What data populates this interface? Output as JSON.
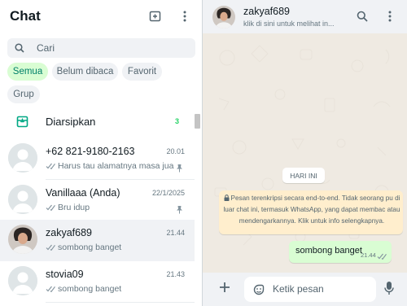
{
  "sidebar": {
    "title": "Chat",
    "search_placeholder": "Cari",
    "filters": [
      {
        "label": "Semua",
        "active": true
      },
      {
        "label": "Belum dibaca",
        "active": false
      },
      {
        "label": "Favorit",
        "active": false
      },
      {
        "label": "Grup",
        "active": false
      }
    ],
    "archived": {
      "label": "Diarsipkan",
      "count": "3"
    },
    "chats": [
      {
        "name": "+62 821-9180-2163",
        "time": "20.01",
        "preview": "Harus tau alamatnya masa jual...",
        "pinned": true,
        "selected": false
      },
      {
        "name": "Vanillaaa (Anda)",
        "time": "22/1/2025",
        "preview": "Bru idup",
        "pinned": true,
        "selected": false
      },
      {
        "name": "zakyaf689",
        "time": "21.44",
        "preview": "sombong banget",
        "pinned": false,
        "selected": true
      },
      {
        "name": "stovia09",
        "time": "21.43",
        "preview": "sombong banget",
        "pinned": false,
        "selected": false
      }
    ]
  },
  "conversation": {
    "name": "zakyaf689",
    "subtitle": "klik di sini untuk melihat in...",
    "date_chip": "HARI INI",
    "encryption_notice": "Pesan terenkripsi secara end-to-end. Tidak seorang pu di luar chat ini, termasuk WhatsApp, yang dapat membac atau mendengarkannya. Klik untuk info selengkapnya.",
    "messages": [
      {
        "text": "sombong banget",
        "time": "21.44",
        "outgoing": true,
        "read": false
      }
    ],
    "composer_placeholder": "Ketik pesan"
  },
  "colors": {
    "accent": "#00a884",
    "active_chip_bg": "#d9fdd3",
    "active_chip_text": "#008069",
    "outgoing_bubble": "#d9fdd3",
    "chat_bg": "#efeae2",
    "notice_bg": "#ffeecd",
    "unread_count": "#25d366"
  },
  "icons": [
    "new-chat-icon",
    "menu-icon",
    "search-icon",
    "archive-icon",
    "pin-icon",
    "double-check-icon",
    "lock-icon",
    "plus-icon",
    "emoji-icon",
    "mic-icon"
  ]
}
